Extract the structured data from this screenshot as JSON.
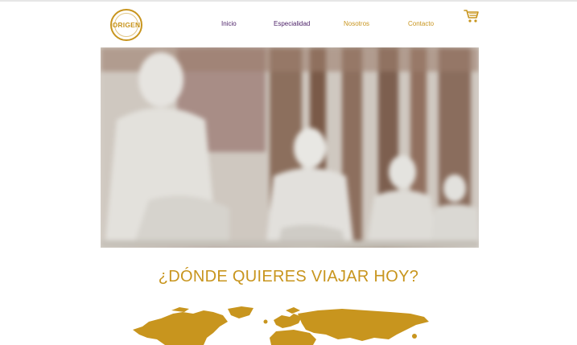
{
  "brand": {
    "logo_text": "ORIGEN",
    "accent_color": "#c8951e",
    "nav_purple": "#4a1e66"
  },
  "nav": {
    "items": [
      {
        "label": "Inicio"
      },
      {
        "label": "Especialidad"
      },
      {
        "label": "Nosotros"
      },
      {
        "label": "Contacto"
      }
    ]
  },
  "header": {
    "cart_icon": "shopping-cart-icon"
  },
  "hero": {
    "image_description": ""
  },
  "main": {
    "heading": "¿DÓNDE QUIERES VIAJAR HOY?"
  },
  "map": {
    "icon": "world-map-icon"
  }
}
